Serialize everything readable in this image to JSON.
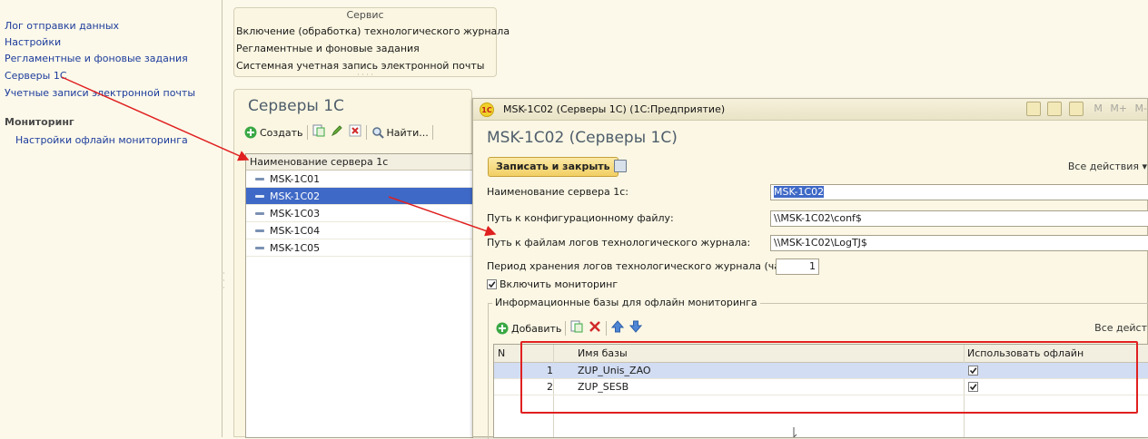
{
  "left_nav": {
    "items": [
      {
        "label": "Лог отправки данных"
      },
      {
        "label": "Настройки"
      },
      {
        "label": "Регламентные и фоновые задания"
      },
      {
        "label": "Серверы 1С"
      },
      {
        "label": "Учетные записи электронной почты"
      }
    ],
    "section_title": "Мониторинг",
    "section_items": [
      {
        "label": "Настройки офлайн мониторинга"
      }
    ]
  },
  "service": {
    "title": "Сервис",
    "links": [
      {
        "label": "Включение (обработка) технологического журнала"
      },
      {
        "label": "Регламентные и фоновые задания"
      },
      {
        "label": "Системная учетная запись электронной почты"
      }
    ]
  },
  "servers_list": {
    "title": "Серверы 1С",
    "toolbar": {
      "create_label": "Создать",
      "find_label": "Найти..."
    },
    "column_header": "Наименование сервера 1с",
    "rows": [
      {
        "name": "MSK-1C01"
      },
      {
        "name": "MSK-1C02",
        "selected": true
      },
      {
        "name": "MSK-1C03"
      },
      {
        "name": "MSK-1C04"
      },
      {
        "name": "MSK-1C05"
      }
    ]
  },
  "form": {
    "window_title": "MSK-1C02 (Серверы 1С)  (1С:Предприятие)",
    "titlebar_m_labels": [
      "M",
      "M+",
      "M-"
    ],
    "heading": "MSK-1C02 (Серверы 1С)",
    "save_close_label": "Записать и закрыть",
    "all_actions_label": "Все действия ▾",
    "fields": {
      "server_name_label": "Наименование сервера 1с:",
      "server_name_value": "MSK-1C02",
      "config_path_label": "Путь к конфигурационному файлу:",
      "config_path_value": "\\\\MSK-1C02\\conf$",
      "log_path_label": "Путь к файлам логов технологического журнала:",
      "log_path_value": "\\\\MSK-1C02\\LogTJ$",
      "retention_label": "Период хранения логов технологического журнала (часов):",
      "retention_value": "1"
    },
    "monitoring_checkbox_label": "Включить мониторинг",
    "monitoring_checked": true,
    "group_title": "Информационные базы для офлайн мониторинга",
    "bases_toolbar": {
      "add_label": "Добавить",
      "all_actions_label": "Все дейст"
    },
    "bases_table": {
      "columns": [
        "N",
        "Имя базы",
        "Использовать офлайн мониторинг"
      ],
      "rows": [
        {
          "n": "1",
          "name": "ZUP_Unis_ZAO",
          "use_offline": true,
          "selected": true
        },
        {
          "n": "2",
          "name": "ZUP_SESB",
          "use_offline": true,
          "selected": false
        }
      ]
    }
  },
  "colors": {
    "annotation": "#e02020",
    "selection": "#3f69c6",
    "link": "#1d3c9c"
  }
}
